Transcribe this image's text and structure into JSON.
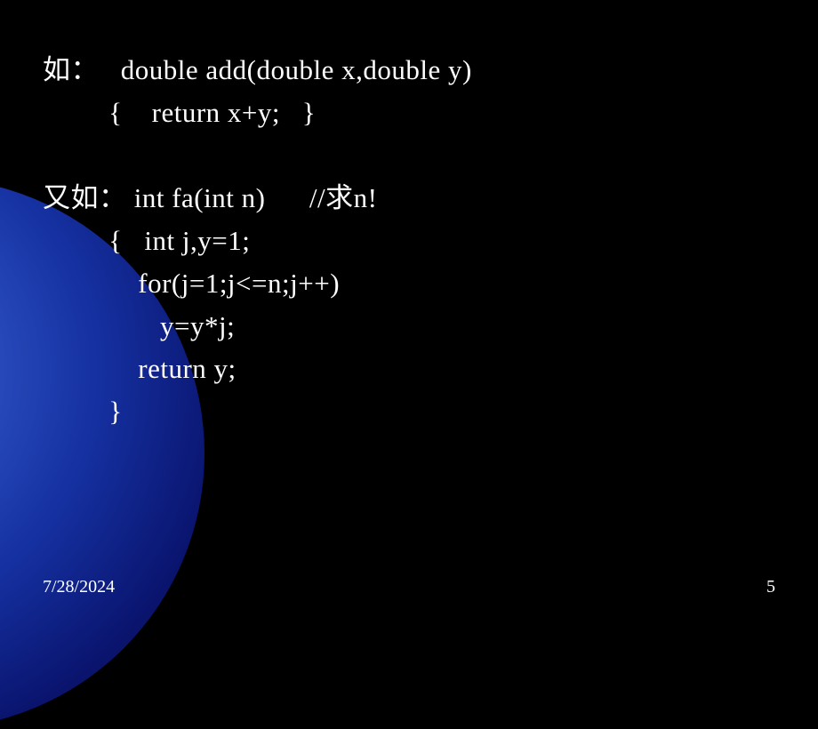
{
  "slide": {
    "example1": {
      "label": "如：",
      "line1": "double add(double x,double y)",
      "line2": "{    return x+y;   }"
    },
    "example2": {
      "label": "又如：",
      "line1": "int fa(int n)      //求n!",
      "line2": "{   int j,y=1;",
      "line3": "    for(j=1;j<=n;j++)",
      "line4": "       y=y*j;",
      "line5": "    return y;",
      "line6": "}"
    },
    "footer": {
      "date": "7/28/2024",
      "page": "5"
    }
  }
}
